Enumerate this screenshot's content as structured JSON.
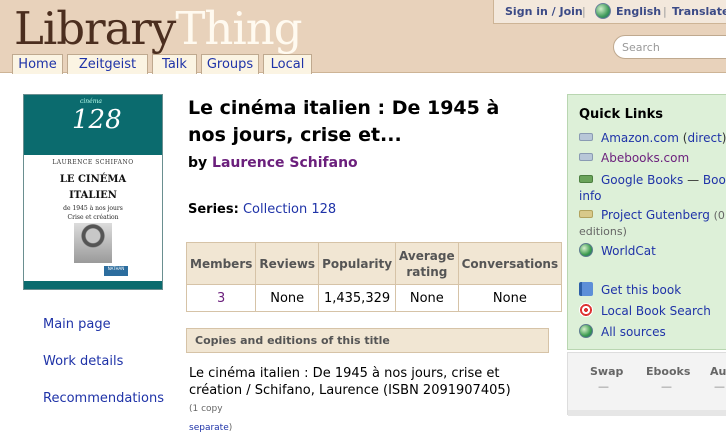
{
  "header": {
    "logo_part1": "Library",
    "logo_part2": "Thing",
    "sign_in": "Sign in / Join",
    "language": "English",
    "translate": "Translate",
    "search_placeholder": "Search"
  },
  "nav": {
    "tabs": [
      {
        "label": "Home"
      },
      {
        "label": "Zeitgeist"
      },
      {
        "label": "Talk"
      },
      {
        "label": "Groups"
      },
      {
        "label": "Local"
      }
    ]
  },
  "cover": {
    "series_small": "cinéma",
    "series_number": "128",
    "author": "LAURENCE SCHIFANO",
    "title_line1": "LE CINÉMA",
    "title_line2": "ITALIEN",
    "subtitle_line1": "de 1945 à nos jours",
    "subtitle_line2": "Crise et création",
    "publisher": "NATHAN"
  },
  "left_links": [
    {
      "label": "Main page"
    },
    {
      "label": "Work details"
    },
    {
      "label": "Recommendations"
    }
  ],
  "work": {
    "title_line1": "Le cinéma italien : De 1945 à",
    "title_line2": "nos jours, crise et...",
    "by_label": "by",
    "author": "Laurence Schifano",
    "series_label": "Series:",
    "series_value": "Collection 128"
  },
  "stats": {
    "headers": {
      "members": "Members",
      "reviews": "Reviews",
      "popularity": "Popularity",
      "average_rating_1": "Average",
      "average_rating_2": "rating",
      "conversations": "Conversations"
    },
    "values": {
      "members": "3",
      "reviews": "None",
      "popularity": "1,435,329",
      "average_rating": "None",
      "conversations": "None"
    }
  },
  "copies": {
    "heading": "Copies and editions of this title",
    "line1": "Le cinéma italien : De 1945 à nos jours, crise et",
    "line2": "création / Schifano, Laurence (ISBN 2091907405)",
    "copy_count": "(1 copy",
    "separate": "separate",
    "close_paren": ")"
  },
  "quick_links": {
    "heading": "Quick Links",
    "amazon": "Amazon.com",
    "amazon_direct": "direct",
    "abebooks": "Abebooks.com",
    "google_books": "Google Books",
    "google_dash": "—",
    "google_books_info_a": "Book",
    "google_books_info_b": "info",
    "gutenberg": "Project Gutenberg",
    "gutenberg_count": "(0",
    "gutenberg_count2": "editions)",
    "worldcat": "WorldCat",
    "get_this_book": "Get this book",
    "local_book_search": "Local Book Search",
    "all_sources": "All sources"
  },
  "bottom_box": {
    "swap_label": "Swap",
    "swap_value": "—",
    "ebooks_label": "Ebooks",
    "ebooks_value": "—",
    "third_label": "Au",
    "third_value": "—"
  },
  "colors": {
    "header_bg": "#e8d2bb",
    "link": "#1f33a8",
    "author": "#6b1f7c",
    "quicklinks_bg": "#ddf0d8",
    "table_header_bg": "#f1e6d3"
  }
}
